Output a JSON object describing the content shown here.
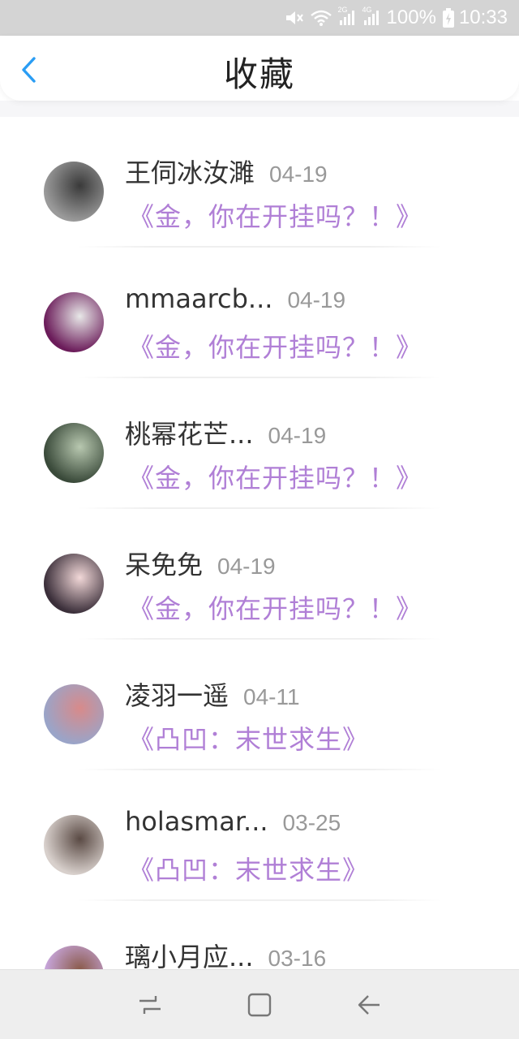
{
  "status_bar": {
    "network_2g": "2G",
    "network_4g": "4G",
    "battery": "100%",
    "time": "10:33",
    "icons": [
      "mute-icon",
      "wifi-icon",
      "signal-icon",
      "signal-icon",
      "battery-charging-icon"
    ]
  },
  "header": {
    "title": "收藏",
    "back_icon": "chevron-left-icon",
    "accent_color": "#2a9df4"
  },
  "favorites": [
    {
      "name": "王伺冰汝濉",
      "date": "04-19",
      "book": "《金，你在开挂吗？！》",
      "avatar_colors": [
        "#9a9a9a",
        "#3a3a3a"
      ]
    },
    {
      "name": "mmaarcb...",
      "date": "04-19",
      "book": "《金，你在开挂吗？！》",
      "avatar_colors": [
        "#6b1c5a",
        "#e8e8e8"
      ]
    },
    {
      "name": "桃幂花芒...",
      "date": "04-19",
      "book": "《金，你在开挂吗？！》",
      "avatar_colors": [
        "#3a4a3a",
        "#b8c8b0"
      ]
    },
    {
      "name": "呆免免",
      "date": "04-19",
      "book": "《金，你在开挂吗？！》",
      "avatar_colors": [
        "#3b2f3a",
        "#f2d8d8"
      ]
    },
    {
      "name": "凌羽一遥",
      "date": "04-11",
      "book": "《凸凹：末世求生》",
      "avatar_colors": [
        "#9aa4c8",
        "#d88a8a"
      ]
    },
    {
      "name": "holasmar...",
      "date": "03-25",
      "book": "《凸凹：末世求生》",
      "avatar_colors": [
        "#d8d0cc",
        "#5a4a44"
      ]
    },
    {
      "name": "璃小月应...",
      "date": "03-16",
      "book": "",
      "avatar_colors": [
        "#c9a8e0",
        "#8a5a4a"
      ]
    }
  ],
  "colors": {
    "book_title": "#b07fd6",
    "name": "#333333",
    "date": "#999999"
  },
  "nav_bar": {
    "icons": [
      "recent-apps-icon",
      "home-icon",
      "back-arrow-icon"
    ]
  }
}
